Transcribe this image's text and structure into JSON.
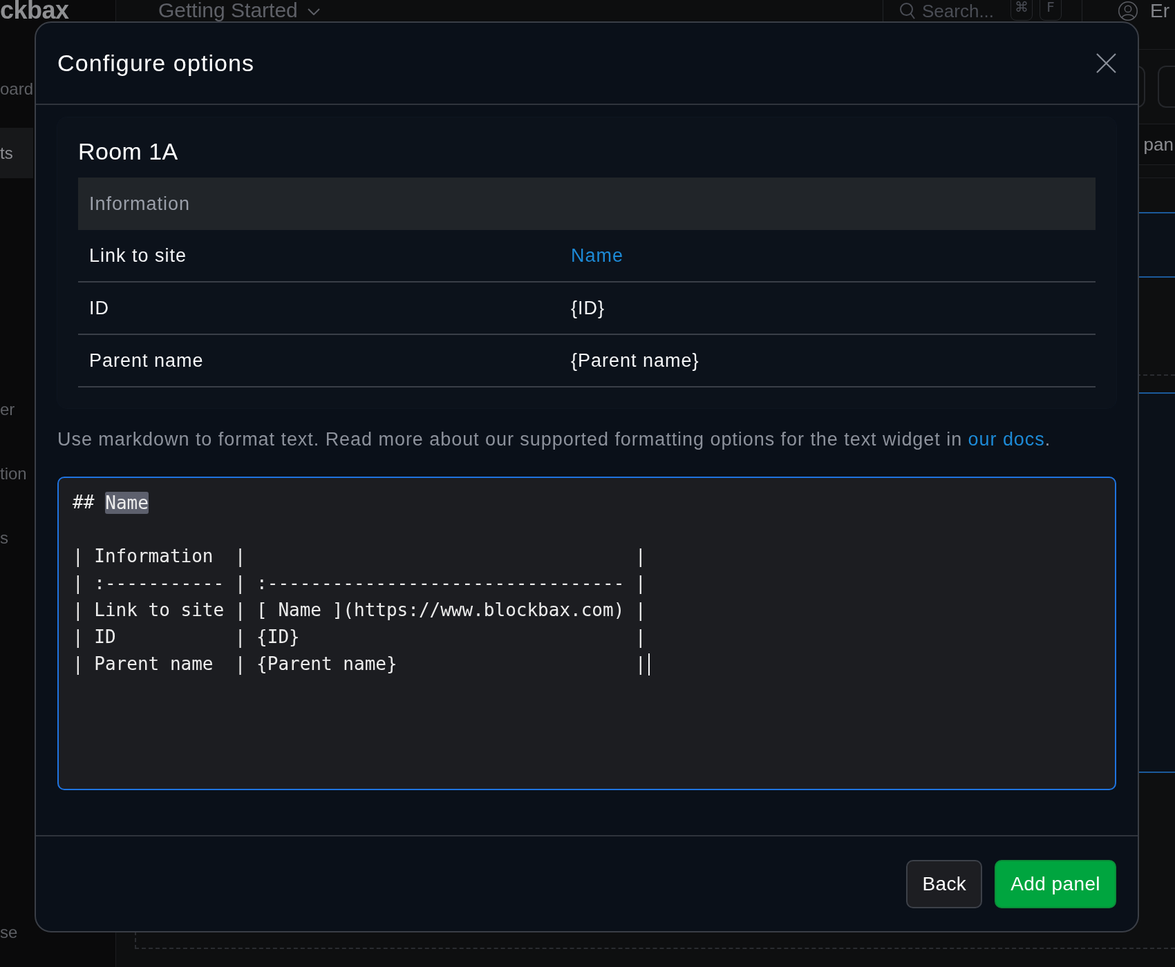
{
  "background": {
    "sidebar": {
      "logo": "ckbax",
      "sections": [
        {
          "items": [
            {
              "label": "oard",
              "selected": false
            },
            {
              "label": "ts",
              "selected": true
            }
          ]
        },
        {
          "items": [
            {
              "label": "er",
              "selected": false
            },
            {
              "label": "tion",
              "selected": false
            },
            {
              "label": "s",
              "selected": false
            }
          ]
        },
        {
          "items": [
            {
              "label": "se",
              "selected": false
            }
          ]
        }
      ]
    },
    "header": {
      "title": "Getting Started",
      "search": {
        "placeholder": "Search...",
        "shortcut": [
          "⌘",
          "F"
        ]
      },
      "user": "Er"
    },
    "toolbar": {
      "tab_label": "pan"
    }
  },
  "dialog": {
    "title": "Configure options",
    "preview": {
      "heading": "Room 1A",
      "table": {
        "header": "Information",
        "rows": [
          {
            "label": "Link to site",
            "value": "Name",
            "kind": "link"
          },
          {
            "label": "ID",
            "value": "{ID}",
            "kind": "text"
          },
          {
            "label": "Parent name",
            "value": "{Parent name}",
            "kind": "text"
          }
        ]
      }
    },
    "help": {
      "text": "Use markdown to format text. Read more about our supported formatting options for the text widget in ",
      "link": "our docs",
      "after": "."
    },
    "editor": {
      "focused": true,
      "heading": {
        "marker": "##",
        "text": "Name",
        "selected": true
      },
      "lines": [
        "| Information  |                                    |",
        "| :----------- | :--------------------------------- |",
        "| Link to site | [ Name ](https://www.blockbax.com) |",
        "| ID           | {ID}                               |",
        "| Parent name  | {Parent name}                      |"
      ]
    },
    "buttons": [
      {
        "label": "Back",
        "kind": "secondary"
      },
      {
        "label": "Add panel",
        "kind": "primary"
      }
    ]
  }
}
